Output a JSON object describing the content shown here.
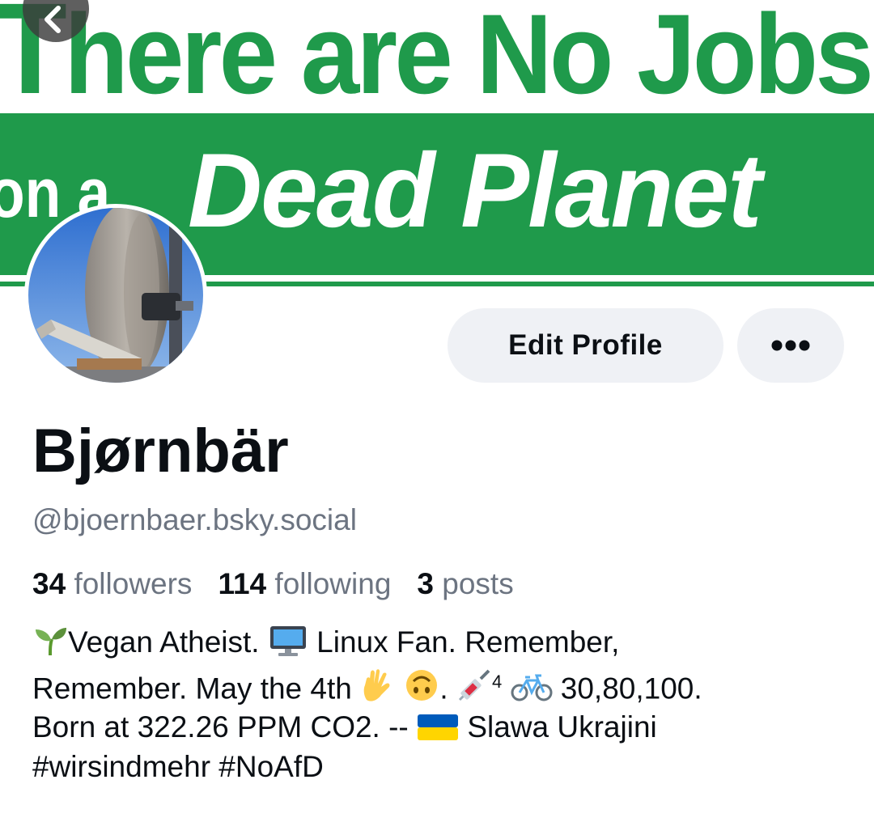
{
  "banner": {
    "line1_prefix": "T",
    "line1_rest": "here are No Jobs",
    "line2_small": "on a",
    "line2_big": "Dead Planet",
    "color": "#1f9a4b"
  },
  "actions": {
    "edit_profile_label": "Edit Profile",
    "more_label": "•••"
  },
  "profile": {
    "display_name": "Bjørnbär",
    "handle": "@bjoernbaer.bsky.social"
  },
  "stats": {
    "followers_count": "34",
    "followers_label": "followers",
    "following_count": "114",
    "following_label": "following",
    "posts_count": "3",
    "posts_label": "posts"
  },
  "bio": {
    "l1_a": "Vegan Atheist.",
    "l1_b": "Linux Fan.  Remember,",
    "l2_a": "Remember. May the 4th",
    "l2_b": ".",
    "l2_sup": "4",
    "l2_c": "30,80,100.",
    "l3_a": "Born at 322.26 PPM CO2. --",
    "l3_b": "Slawa Ukrajini",
    "l4": "#wirsindmehr #NoAfD"
  },
  "icons": {
    "back": "chevron-left-icon",
    "more": "ellipsis-icon",
    "bio_emojis": [
      "seedling-icon",
      "desktop-computer-icon",
      "vulcan-salute-icon",
      "upside-down-face-icon",
      "syringe-icon",
      "bicycle-icon",
      "ukraine-flag-icon"
    ]
  },
  "colors": {
    "text_primary": "#0b0f14",
    "text_secondary": "#6c7481",
    "button_bg": "#eff1f5"
  }
}
